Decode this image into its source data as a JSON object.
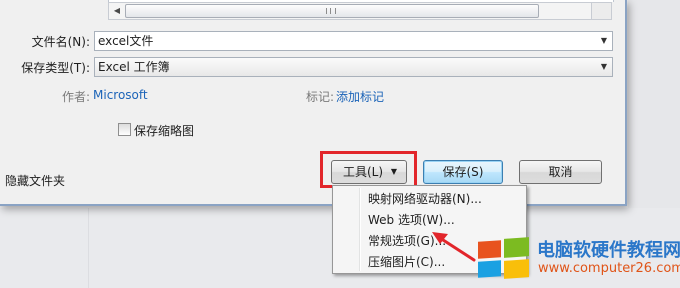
{
  "form": {
    "filename_label": "文件名(N):",
    "filename_value": "excel文件",
    "savetype_label": "保存类型(T):",
    "savetype_value": "Excel 工作簿",
    "author_label": "作者:",
    "author_value": "Microsoft",
    "tags_label": "标记:",
    "tags_value": "添加标记",
    "thumbnail_label": "保存缩略图",
    "thumbnail_checked": false
  },
  "footer": {
    "hide_folders": "隐藏文件夹",
    "tools_label": "工具(L)",
    "save_label": "保存(S)",
    "cancel_label": "取消"
  },
  "tools_menu": [
    {
      "label": "映射网络驱动器(N)..."
    },
    {
      "label": "Web 选项(W)..."
    },
    {
      "label": "常规选项(G)..."
    },
    {
      "label": "压缩图片(C)..."
    }
  ],
  "watermark": {
    "title": "电脑软硬件教程网",
    "url": "www.computer26.com"
  },
  "colors": {
    "highlight": "#e2262b",
    "link": "#1c64b8",
    "brand_blue": "#2b77c9",
    "brand_url": "#e05418"
  }
}
